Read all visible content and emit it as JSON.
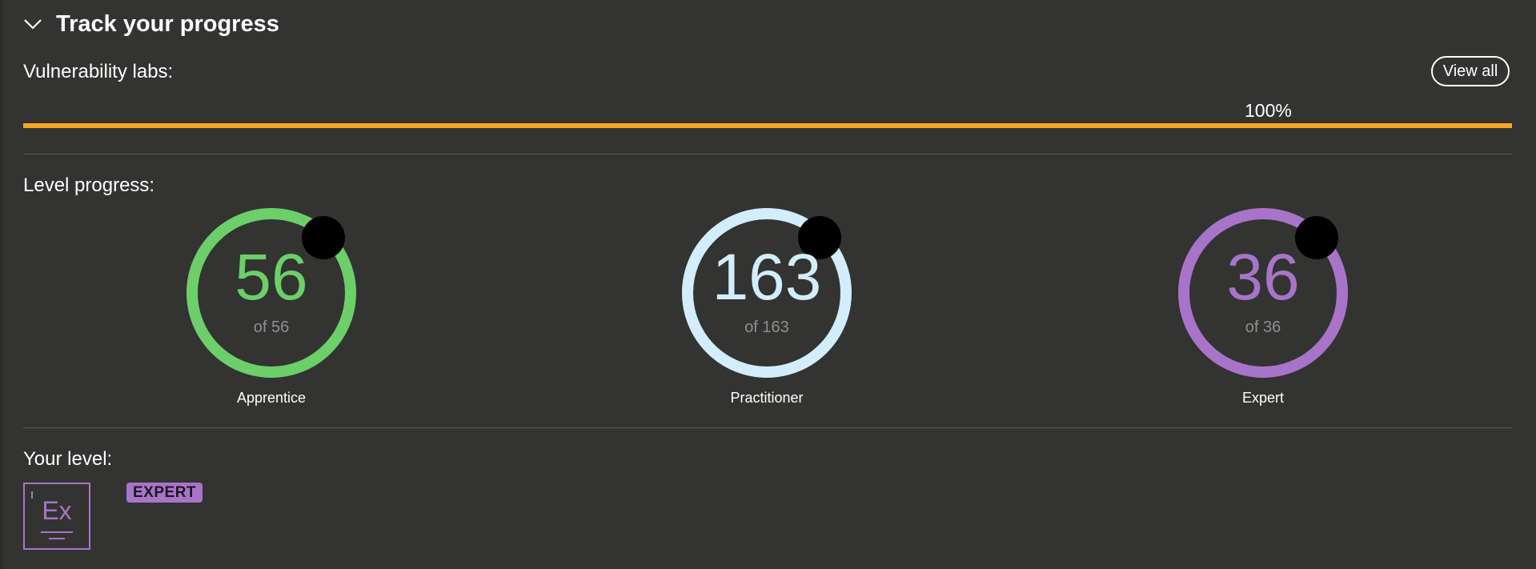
{
  "header": {
    "title": "Track your progress",
    "toggle_icon": "chevron-down-icon"
  },
  "vulnerability_labs": {
    "label": "Vulnerability labs:",
    "view_all_label": "View all",
    "percent_text": "100%",
    "progress": 1.0,
    "bar_color": "#f5a623"
  },
  "level_progress": {
    "label": "Level progress:",
    "levels": [
      {
        "name": "Apprentice",
        "value": "56",
        "total_text": "of 56",
        "completed": 56,
        "total": 56,
        "color": "#6ccf6a"
      },
      {
        "name": "Practitioner",
        "value": "163",
        "total_text": "of 163",
        "completed": 163,
        "total": 163,
        "color": "#d2eefc"
      },
      {
        "name": "Expert",
        "value": "36",
        "total_text": "of 36",
        "completed": 36,
        "total": 36,
        "color": "#a874c9"
      }
    ]
  },
  "your_level": {
    "label": "Your level:",
    "badge_text": "Ex",
    "level_tag": "EXPERT",
    "color": "#a874c9"
  }
}
